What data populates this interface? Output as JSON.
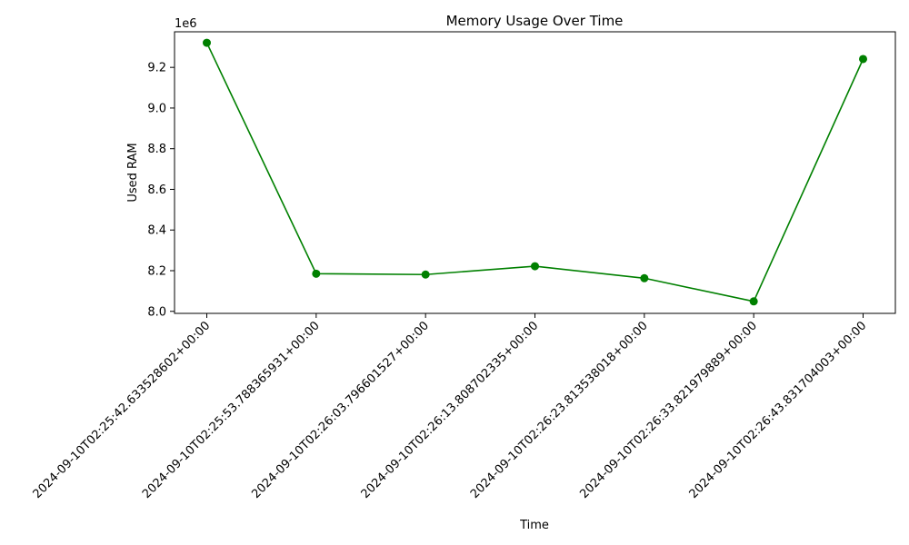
{
  "chart_data": {
    "type": "line",
    "title": "Memory Usage Over Time",
    "xlabel": "Time",
    "ylabel": "Used RAM",
    "y_offset_label": "1e6",
    "y_scale": 1000000,
    "categories": [
      "2024-09-10T02:25:42.633528602+00:00",
      "2024-09-10T02:25:53.788365931+00:00",
      "2024-09-10T02:26:03.796601527+00:00",
      "2024-09-10T02:26:13.808702335+00:00",
      "2024-09-10T02:26:23.813538018+00:00",
      "2024-09-10T02:26:33.821979889+00:00",
      "2024-09-10T02:26:43.831704003+00:00"
    ],
    "values": [
      9321000,
      8185000,
      8181000,
      8222000,
      8163000,
      8049000,
      9241000
    ],
    "ylim": [
      7990000,
      9375000
    ],
    "yticks": [
      8000000,
      8200000,
      8400000,
      8600000,
      8800000,
      9000000,
      9200000
    ],
    "ytick_labels": [
      "8.0",
      "8.2",
      "8.4",
      "8.6",
      "8.8",
      "9.0",
      "9.2"
    ],
    "line_color": "#008000",
    "grid": false,
    "marker": "circle"
  }
}
